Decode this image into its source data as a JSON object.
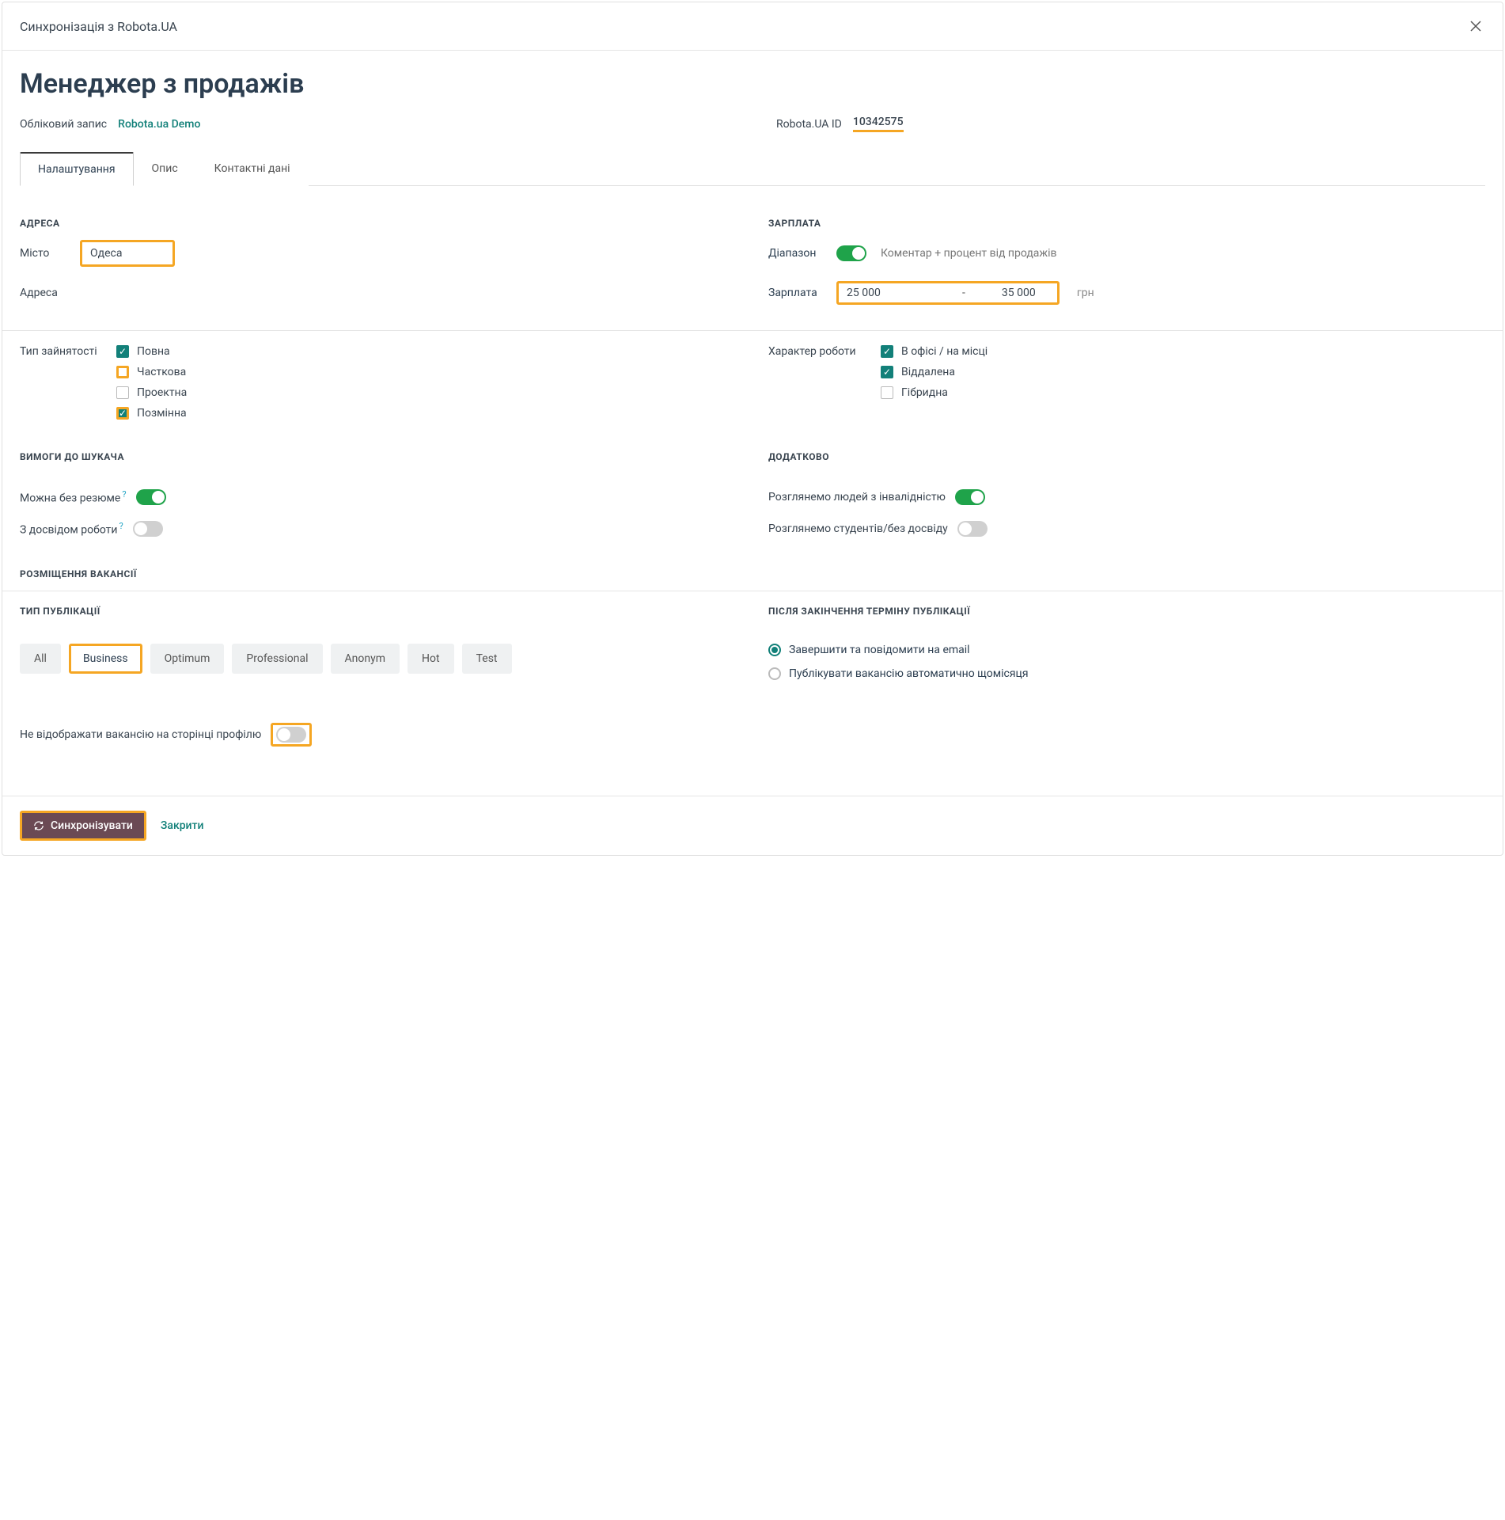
{
  "header": {
    "title": "Синхронізація з Robota.UA"
  },
  "page": {
    "title": "Менеджер з продажів",
    "account_label": "Обліковий запис",
    "account_value": "Robota.ua Demo",
    "id_label": "Robota.UA ID",
    "id_value": "10342575"
  },
  "tabs": {
    "settings": "Налаштування",
    "description": "Опис",
    "contacts": "Контактні дані"
  },
  "address": {
    "section": "АДРЕСА",
    "city_label": "Місто",
    "city_value": "Одеса",
    "addr_label": "Адреса"
  },
  "salary": {
    "section": "ЗАРПЛАТА",
    "range_label": "Діапазон",
    "comment": "Коментар + процент від продажів",
    "salary_label": "Зарплата",
    "from": "25 000",
    "sep": "-",
    "to": "35 000",
    "currency": "грн"
  },
  "employment": {
    "label": "Тип зайнятості",
    "full": "Повна",
    "part": "Часткова",
    "project": "Проектна",
    "shift": "Позмінна"
  },
  "nature": {
    "label": "Характер роботи",
    "office": "В офісі / на місці",
    "remote": "Віддалена",
    "hybrid": "Гібридна"
  },
  "requirements": {
    "section": "ВИМОГИ ДО ШУКАЧА",
    "no_resume": "Можна без резюме",
    "experience": "З досвідом роботи"
  },
  "additional": {
    "section": "ДОДАТКОВО",
    "disability": "Розглянемо людей з інвалідністю",
    "students": "Розглянемо студентів/без досвіду"
  },
  "placement": {
    "section": "РОЗМІЩЕННЯ ВАКАНСІЇ"
  },
  "pubtype": {
    "section": "ТИП ПУБЛІКАЦІЇ",
    "all": "All",
    "business": "Business",
    "optimum": "Optimum",
    "professional": "Professional",
    "anonym": "Anonym",
    "hot": "Hot",
    "test": "Test"
  },
  "after": {
    "section": "ПІСЛЯ ЗАКІНЧЕННЯ ТЕРМІНУ ПУБЛІКАЦІЇ",
    "finish": "Завершити та повідомити на email",
    "auto": "Публікувати вакансію автоматично щомісяця"
  },
  "hide_profile": "Не відображати вакансію на сторінці профілю",
  "footer": {
    "sync": "Синхронізувати",
    "close": "Закрити"
  },
  "help": "?"
}
